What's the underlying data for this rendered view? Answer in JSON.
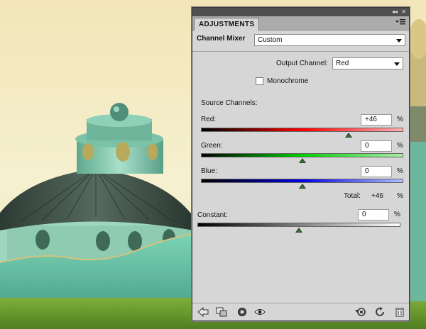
{
  "panel": {
    "tab_label": "ADJUSTMENTS",
    "adjustment_name": "Channel Mixer",
    "preset": {
      "selected": "Custom"
    },
    "output_channel": {
      "label": "Output Channel:",
      "selected": "Red"
    },
    "monochrome": {
      "label": "Monochrome",
      "checked": false
    },
    "source_channels_label": "Source Channels:",
    "channels": [
      {
        "label": "Red:",
        "value": "+46",
        "unit": "%",
        "level": 0.73,
        "gradient": [
          "#000000",
          "#ff0000",
          "#ffb0b0"
        ]
      },
      {
        "label": "Green:",
        "value": "0",
        "unit": "%",
        "level": 0.5,
        "gradient": [
          "#000000",
          "#00d000",
          "#a8f0a8"
        ]
      },
      {
        "label": "Blue:",
        "value": "0",
        "unit": "%",
        "level": 0.5,
        "gradient": [
          "#000000",
          "#0000e0",
          "#b0c0ff"
        ]
      }
    ],
    "total": {
      "label": "Total:",
      "value": "+46",
      "unit": "%"
    },
    "constant": {
      "label": "Constant:",
      "value": "0",
      "unit": "%",
      "level": 0.5
    },
    "footer_icons": [
      "back-arrow-icon",
      "clip-to-layer-icon",
      "layer-visibility-state-icon",
      "eye-visibility-icon",
      "reset-previous-state-icon",
      "reset-default-icon",
      "trash-icon"
    ]
  }
}
